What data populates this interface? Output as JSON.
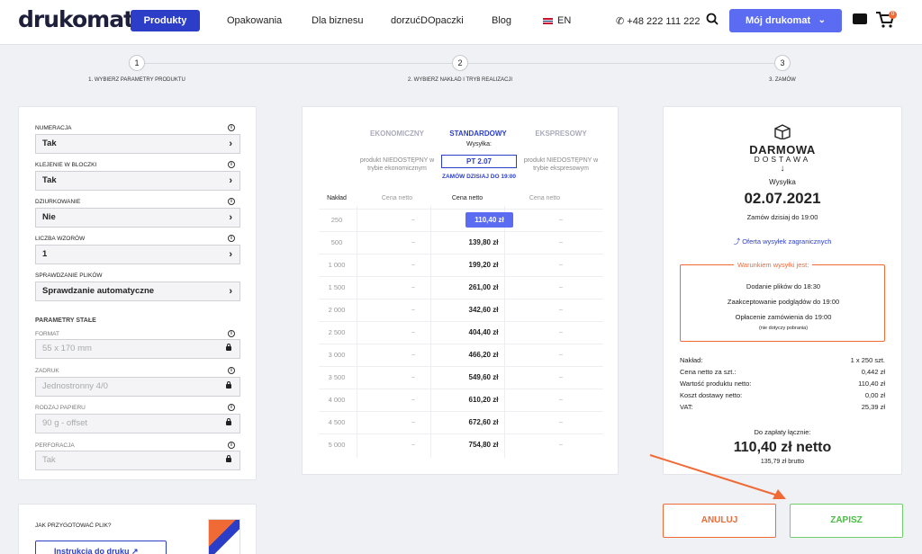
{
  "nav": {
    "logo": "drukomat.",
    "products": "Produkty",
    "links": [
      "Opakowania",
      "Dla biznesu",
      "dorzućDOpaczki",
      "Blog"
    ],
    "lang": "EN",
    "phone": "+48 222 111 222",
    "account": "Mój drukomat",
    "cart_count": "0"
  },
  "steps": [
    {
      "n": "1",
      "label": "1. WYBIERZ PARAMETRY PRODUKTU"
    },
    {
      "n": "2",
      "label": "2. WYBIERZ NAKŁAD I TRYB REALIZACJI"
    },
    {
      "n": "3",
      "label": "3. ZAMÓW"
    }
  ],
  "params": {
    "numeracja": {
      "label": "NUMERACJA",
      "value": "Tak"
    },
    "klejenie": {
      "label": "KLEJENIE W BLOCZKI",
      "value": "Tak"
    },
    "dziurkowanie": {
      "label": "DZIURKOWANIE",
      "value": "Nie"
    },
    "wzory": {
      "label": "LICZBA WZORÓW",
      "value": "1"
    },
    "sprawdzanie": {
      "label": "SPRAWDZANIE PLIKÓW",
      "value": "Sprawdzanie automatyczne"
    }
  },
  "fixed": {
    "title": "PARAMETRY STAŁE",
    "format": {
      "label": "FORMAT",
      "value": "55 x 170 mm"
    },
    "zadruk": {
      "label": "ZADRUK",
      "value": "Jednostronny 4/0"
    },
    "papier": {
      "label": "RODZAJ PAPIERU",
      "value": "90 g - offset"
    },
    "perforacja": {
      "label": "PERFORACJA",
      "value": "Tak"
    }
  },
  "howto": {
    "title": "JAK PRZYGOTOWAĆ PLIK?",
    "button": "Instrukcja do druku"
  },
  "pricing": {
    "modes": [
      "EKONOMICZNY",
      "STANDARDOWY",
      "EKSPRESOWY"
    ],
    "eko_note": "produkt NIEDOSTĘPNY w trybie ekonomicznym",
    "exp_note": "produkt NIEDOSTĘPNY w trybie ekspresowym",
    "ship_label": "Wysyłka:",
    "ship_date": "PT 2.07",
    "order_note": "ZAMÓW DZISIAJ DO 19:00",
    "headers": [
      "Nakład",
      "Cena netto",
      "Cena netto",
      "Cena netto"
    ],
    "dash": "–",
    "rows": [
      {
        "q": "250",
        "p": "110,40 zł"
      },
      {
        "q": "500",
        "p": "139,80 zł"
      },
      {
        "q": "1 000",
        "p": "199,20 zł"
      },
      {
        "q": "1 500",
        "p": "261,00 zł"
      },
      {
        "q": "2 000",
        "p": "342,60 zł"
      },
      {
        "q": "2 500",
        "p": "404,40 zł"
      },
      {
        "q": "3 000",
        "p": "466,20 zł"
      },
      {
        "q": "3 500",
        "p": "549,60 zł"
      },
      {
        "q": "4 000",
        "p": "610,20 zł"
      },
      {
        "q": "4 500",
        "p": "672,60 zł"
      },
      {
        "q": "5 000",
        "p": "754,80 zł"
      }
    ]
  },
  "summary": {
    "free1": "DARMOWA",
    "free2": "DOSTAWA",
    "ship_label": "Wysyłka",
    "ship_date": "02.07.2021",
    "order_by": "Zamów dzisiaj do 19:00",
    "intl": "Oferta wysyłek zagranicznych",
    "cond_title": "Warunkiem wysyłki jest:",
    "cond": [
      "Dodanie plików do 18:30",
      "Zaakceptowanie podglądów do 19:00",
      "Opłacenie zamówienia do 19:00"
    ],
    "cond_note": "(nie dotyczy pobrania)",
    "lines": [
      {
        "k": "Nakład:",
        "v": "1 x 250 szt."
      },
      {
        "k": "Cena netto za szt.:",
        "v": "0,442 zł"
      },
      {
        "k": "Wartość produktu netto:",
        "v": "110,40 zł"
      },
      {
        "k": "Koszt dostawy netto:",
        "v": "0,00 zł"
      },
      {
        "k": "VAT:",
        "v": "25,39 zł"
      }
    ],
    "total_label": "Do zapłaty łącznie:",
    "total": "110,40 zł netto",
    "gross": "135,79 zł brutto"
  },
  "actions": {
    "cancel": "ANULUJ",
    "save": "ZAPISZ"
  },
  "colors": {
    "primary": "#2c3ec7",
    "accent": "#5b6cf2",
    "orange": "#f06a36",
    "green": "#4cbb45"
  }
}
